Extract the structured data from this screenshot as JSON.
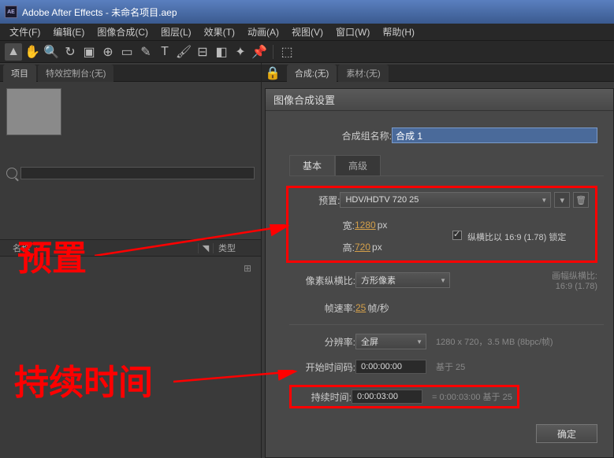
{
  "window_title": "Adobe After Effects - 未命名项目.aep",
  "menu": [
    "文件(F)",
    "编辑(E)",
    "图像合成(C)",
    "图层(L)",
    "效果(T)",
    "动画(A)",
    "视图(V)",
    "窗口(W)",
    "帮助(H)"
  ],
  "panels": {
    "project_tab": "项目",
    "effects_tab": "特效控制台:(无)",
    "comp_tab": "合成:(无)",
    "footage_tab": "素材:(无)",
    "col_name": "名称",
    "col_type": "类型"
  },
  "dialog": {
    "title": "图像合成设置",
    "name_label": "合成组名称:",
    "name_value": "合成 1",
    "tab_basic": "基本",
    "tab_advanced": "高级",
    "preset_label": "预置:",
    "preset_value": "HDV/HDTV 720 25",
    "width_label": "宽:",
    "width_value": "1280",
    "px": "px",
    "height_label": "高:",
    "height_value": "720",
    "lock_aspect": "纵横比以 16:9 (1.78) 锁定",
    "pixel_ratio_label": "像素纵横比:",
    "pixel_ratio_value": "方形像素",
    "frame_aspect_label": "画幅纵横比:",
    "frame_aspect_value": "16:9 (1.78)",
    "framerate_label": "帧速率:",
    "framerate_value": "25",
    "framerate_unit": "帧/秒",
    "resolution_label": "分辨率:",
    "resolution_value": "全屏",
    "resolution_info": "1280 x 720，3.5 MB (8bpc/帧)",
    "start_tc_label": "开始时间码:",
    "start_tc_value": "0:00:00:00",
    "start_tc_info": "基于 25",
    "duration_label": "持续时间:",
    "duration_value": "0:00:03:00",
    "duration_info": "= 0:00:03:00  基于 25",
    "ok_button": "确定"
  },
  "annotations": {
    "preset": "预置",
    "duration": "持续时间"
  }
}
